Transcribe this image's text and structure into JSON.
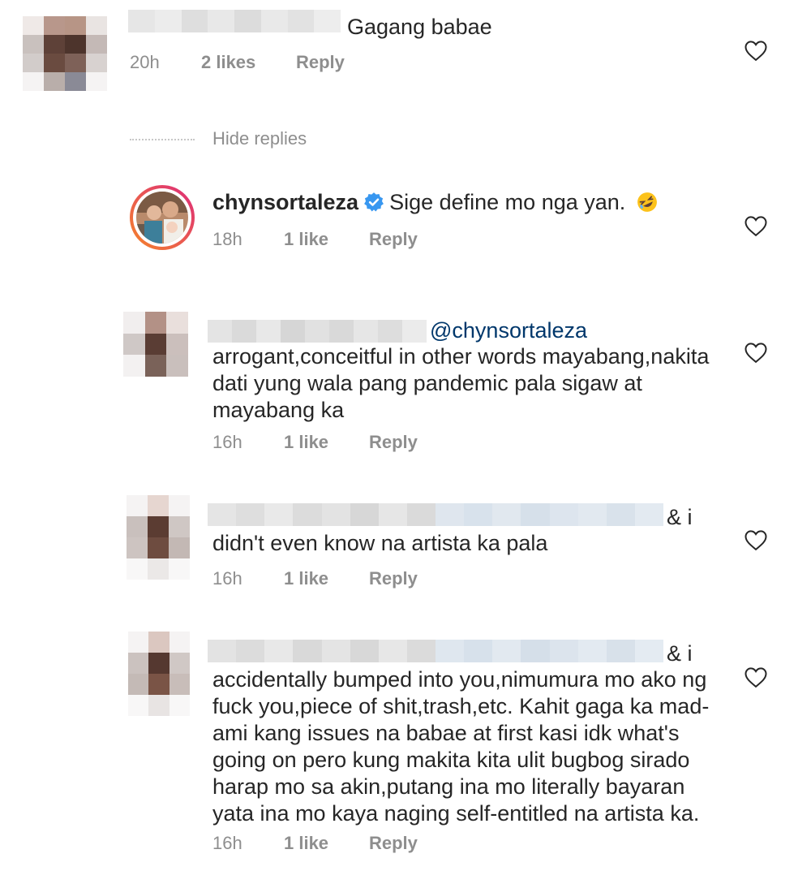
{
  "comments": [
    {
      "text": "Gagang babae",
      "time": "20h",
      "likes": "2 likes",
      "reply": "Reply"
    },
    {
      "username": "chynsortaleza",
      "text": "Sige define mo nga yan.",
      "time": "18h",
      "likes": "1 like",
      "reply": "Reply"
    },
    {
      "mention": "@chynsortaleza",
      "lines": [
        "arrogant,conceitful in other words mayabang,nakita",
        "dati yung wala pang pandemic pala sigaw at",
        "mayabang ka"
      ],
      "time": "16h",
      "likes": "1 like",
      "reply": "Reply"
    },
    {
      "trail": "& i",
      "lines": [
        "didn't even know na artista ka pala"
      ],
      "time": "16h",
      "likes": "1 like",
      "reply": "Reply"
    },
    {
      "trail": "& i",
      "lines": [
        "accidentally bumped into you,nimumura mo ako ng",
        "fuck you,piece of shit,trash,etc. Kahit gaga ka mad-",
        "ami kang issues na babae at first kasi idk what's",
        "going on pero kung makita kita ulit bugbog sirado",
        "harap mo sa akin,putang ina mo literally bayaran",
        "yata ina mo kaya naging self-entitled na artista ka."
      ],
      "time": "16h",
      "likes": "1 like",
      "reply": "Reply"
    }
  ],
  "hide_replies": "Hide replies",
  "colors": {
    "text": "#262626",
    "meta": "#8e8e8e",
    "mention": "#00376b",
    "verified": "#3897f0",
    "story_ring_start": "#f58529",
    "story_ring_end": "#dd2a7b"
  },
  "icons": [
    "heart-outline-icon",
    "verified-badge-icon",
    "rofl-emoji-icon"
  ]
}
